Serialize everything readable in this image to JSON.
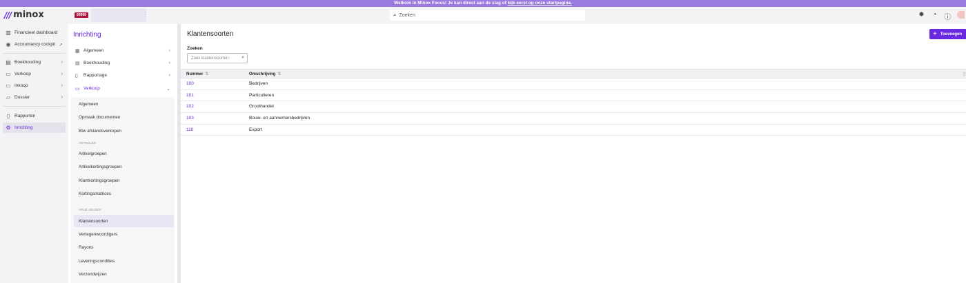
{
  "banner": {
    "text": "Welkom in Minox Focus! Je kan direct aan de slag of ",
    "link": "kijk eerst op onze startpagina."
  },
  "topbar": {
    "logo": "minox",
    "admin_badge": "99999",
    "search_placeholder": "Zoeken",
    "icons": [
      "bug-icon",
      "tasks-icon",
      "help-icon",
      "avatar"
    ]
  },
  "leftnav": {
    "items": [
      {
        "label": "Financieel dashboard",
        "icon": "chart-icon"
      },
      {
        "label": "Accountancy cockpit",
        "icon": "gauge-icon",
        "external": "↗"
      },
      {
        "label": "Boekhouding",
        "icon": "book-icon",
        "chevron": "›"
      },
      {
        "label": "Verkoop",
        "icon": "tag-icon",
        "chevron": "›"
      },
      {
        "label": "Inkoop",
        "icon": "cart-icon",
        "chevron": "›"
      },
      {
        "label": "Dossier",
        "icon": "folder-icon",
        "chevron": "›"
      },
      {
        "label": "Rapporten",
        "icon": "report-icon"
      },
      {
        "label": "Inrichting",
        "icon": "wrench-icon"
      }
    ]
  },
  "subnav": {
    "title": "Inrichting",
    "sections": [
      {
        "label": "Algemeen",
        "icon": "grid-icon"
      },
      {
        "label": "Boekhouding",
        "icon": "book-icon"
      },
      {
        "label": "Rapportage",
        "icon": "report-icon"
      },
      {
        "label": "Verkoop",
        "icon": "tag-icon"
      }
    ],
    "verkoop_items": [
      "Algemeen",
      "Opmaak documenten",
      "Btw afstandsverkopen"
    ],
    "artikelen_label": "ARTIKELEN",
    "artikelen_items": [
      "Artikelgroepen",
      "Artikelkortingsgroepen",
      "Klantkortingsgroepen",
      "Kortingsmatrices"
    ],
    "vrije_velden_label": "VRIJE VELDEN",
    "vrije_velden_items": [
      "Klantensoorten",
      "Vertegenwoordigers",
      "Rayons",
      "Leveringscondities",
      "Verzendwijzen"
    ]
  },
  "main": {
    "title": "Klantensoorten",
    "add_button": "Toevoegen",
    "filter_label": "Zoeken",
    "filter_placeholder": "Zoek klantensoorten",
    "columns": [
      "Nummer",
      "Omschrijving"
    ],
    "rows": [
      {
        "number": "100",
        "description": "Bedrijven"
      },
      {
        "number": "101",
        "description": "Particulieren"
      },
      {
        "number": "102",
        "description": "Groothandel"
      },
      {
        "number": "103",
        "description": "Bouw- en aannemersbedrijven"
      },
      {
        "number": "110",
        "description": "Export"
      }
    ]
  },
  "colors": {
    "accent": "#6a28e0",
    "banner": "#9b7ae0",
    "admin_badge": "#b0153e"
  }
}
